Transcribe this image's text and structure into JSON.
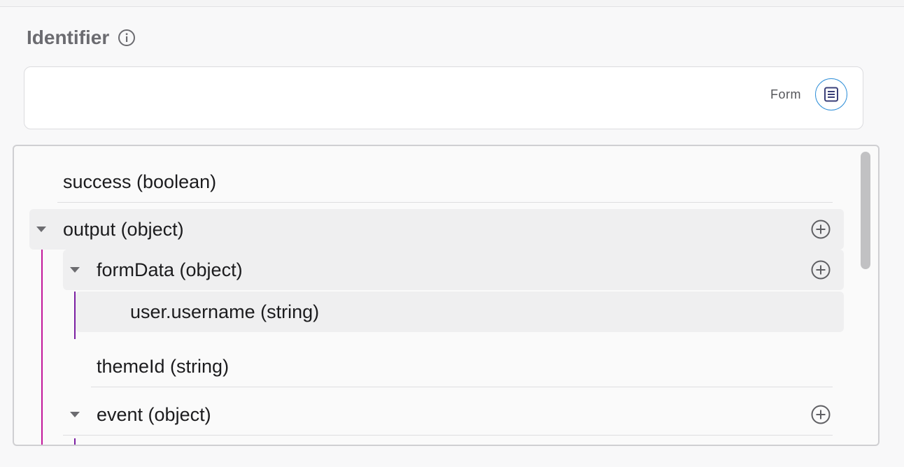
{
  "identifier": {
    "label": "Identifier",
    "value": "",
    "form_label": "Form"
  },
  "tree": {
    "success": "success (boolean)",
    "output": "output (object)",
    "formData": "formData (object)",
    "username": "user.username (string)",
    "themeId": "themeId (string)",
    "event": "event (object)"
  },
  "colors": {
    "output_branch_line": "#c2189b",
    "formdata_branch_line": "#7b1fa2",
    "form_button_accent": "#2f8fd8"
  }
}
